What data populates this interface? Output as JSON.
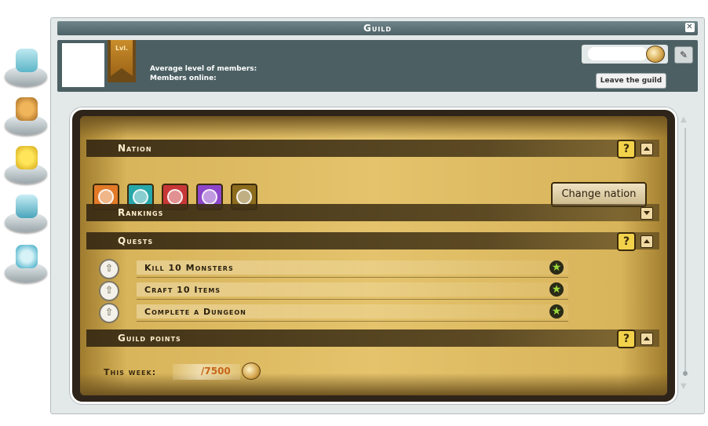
{
  "window": {
    "title": "Guild",
    "close_icon": "close-icon"
  },
  "header": {
    "level_badge": "Lvl.",
    "average_level_label": "Average level of members:",
    "members_online_label": "Members online:",
    "points_value": "",
    "leave_button": "Leave the guild",
    "edit_icon": "pencil-icon"
  },
  "side_tabs": [
    {
      "icon": "guild-emblem-icon",
      "selected": true
    },
    {
      "icon": "members-icon",
      "selected": false
    },
    {
      "icon": "stars-icon",
      "selected": false
    },
    {
      "icon": "guild-emblem-icon",
      "selected": false
    },
    {
      "icon": "haven-world-icon",
      "selected": false
    }
  ],
  "sections": {
    "nation": {
      "title": "Nation",
      "help": "?"
    },
    "rankings": {
      "title": "Rankings"
    },
    "quests": {
      "title": "Quests",
      "help": "?"
    },
    "guild_points": {
      "title": "Guild points",
      "help": "?"
    }
  },
  "nations": [
    {
      "name": "nation-icon-1",
      "color": "#e27a28"
    },
    {
      "name": "nation-icon-2",
      "color": "#27a7a9"
    },
    {
      "name": "nation-icon-3",
      "color": "#c83737"
    },
    {
      "name": "nation-icon-4",
      "color": "#8d46c9"
    },
    {
      "name": "nation-icon-5",
      "color": "#8c6d1e"
    }
  ],
  "change_nation_button": "Change nation",
  "quests": [
    {
      "name": "Kill 10 Monsters"
    },
    {
      "name": "Craft 10 Items"
    },
    {
      "name": "Complete a Dungeon"
    }
  ],
  "guild_points": {
    "this_week_label": "This week:",
    "value": "/7500"
  },
  "colors": {
    "title_bar": "#5a6f73",
    "parchment": "#d8b45a",
    "points_orange": "#c8651a",
    "star_green": "#9bd73b"
  }
}
